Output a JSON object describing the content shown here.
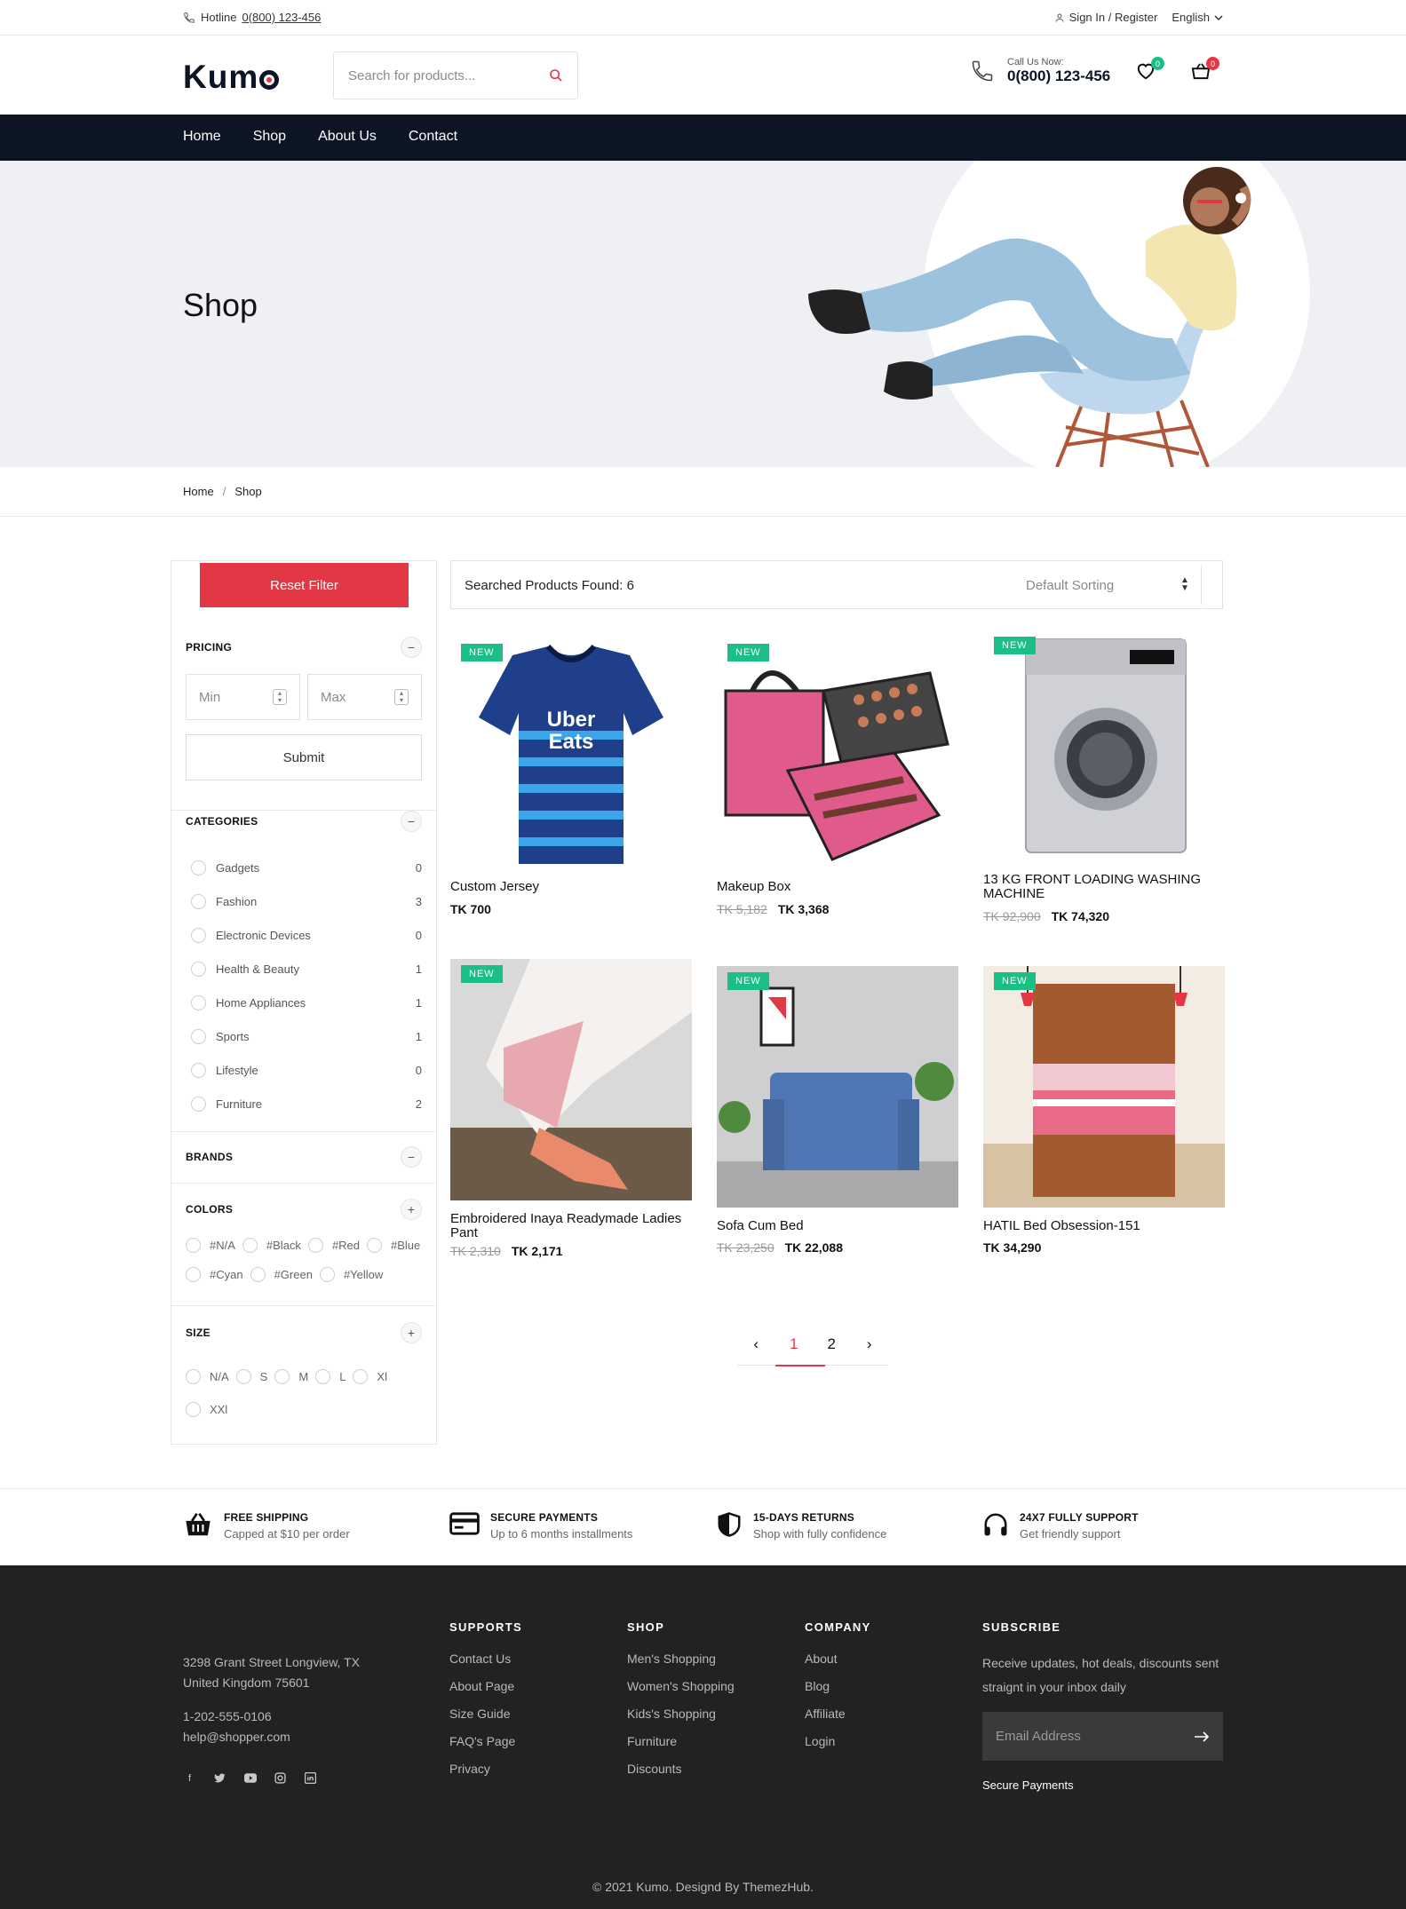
{
  "topbar": {
    "hotline_label": "Hotline",
    "hotline_number": "0(800) 123-456",
    "signin": "Sign In / Register",
    "language": "English"
  },
  "header": {
    "logo": "Kumo",
    "search_placeholder": "Search for products...",
    "call_label": "Call Us Now:",
    "call_number": "0(800) 123-456",
    "wishlist_count": "0",
    "cart_count": "0",
    "colors": {
      "accent": "#e23744",
      "navy": "#0b1524",
      "green": "#1bbf85"
    }
  },
  "nav": [
    "Home",
    "Shop",
    "About Us",
    "Contact"
  ],
  "hero": {
    "title": "Shop"
  },
  "breadcrumb": {
    "home": "Home",
    "sep": "/",
    "current": "Shop"
  },
  "sidebar": {
    "reset": "Reset Filter",
    "pricing": {
      "title": "PRICING",
      "min_placeholder": "Min",
      "max_placeholder": "Max",
      "submit": "Submit"
    },
    "categories": {
      "title": "CATEGORIES",
      "items": [
        {
          "label": "Gadgets",
          "count": "0"
        },
        {
          "label": "Fashion",
          "count": "3"
        },
        {
          "label": "Electronic Devices",
          "count": "0"
        },
        {
          "label": "Health & Beauty",
          "count": "1"
        },
        {
          "label": "Home Appliances",
          "count": "1"
        },
        {
          "label": "Sports",
          "count": "1"
        },
        {
          "label": "Lifestyle",
          "count": "0"
        },
        {
          "label": "Furniture",
          "count": "2"
        }
      ]
    },
    "brands": {
      "title": "BRANDS"
    },
    "colors": {
      "title": "COLORS",
      "row1": [
        "#N/A",
        "#Black",
        "#Red",
        "#Blue"
      ],
      "row2": [
        "#Cyan",
        "#Green",
        "#Yellow"
      ]
    },
    "size": {
      "title": "SIZE",
      "row1": [
        "N/A",
        "S",
        "M",
        "L",
        "Xl"
      ],
      "row2": [
        "XXl"
      ]
    }
  },
  "toolbar": {
    "found": "Searched Products Found: 6",
    "sort": "Default Sorting"
  },
  "products": [
    {
      "tag": "NEW",
      "name": "Custom Jersey",
      "old_price": "",
      "price": "TK 700"
    },
    {
      "tag": "NEW",
      "name": "Makeup Box",
      "old_price": "TK 5,182",
      "price": "TK 3,368"
    },
    {
      "tag": "NEW",
      "name": "13 KG FRONT LOADING WASHING MACHINE",
      "old_price": "TK 92,900",
      "price": "TK 74,320"
    },
    {
      "tag": "NEW",
      "name": "Embroidered Inaya Readymade Ladies Pant",
      "old_price": "TK 2,310",
      "price": "TK 2,171"
    },
    {
      "tag": "NEW",
      "name": "Sofa Cum Bed",
      "old_price": "TK 23,250",
      "price": "TK 22,088"
    },
    {
      "tag": "NEW",
      "name": "HATIL Bed Obsession-151",
      "old_price": "",
      "price": "TK 34,290"
    }
  ],
  "pagination": {
    "prev": "‹",
    "pages": [
      "1",
      "2"
    ],
    "next": "›",
    "current": "1"
  },
  "features": [
    {
      "icon": "basket-icon",
      "title": "FREE SHIPPING",
      "text": "Capped at $10 per order"
    },
    {
      "icon": "credit-card-icon",
      "title": "SECURE PAYMENTS",
      "text": "Up to 6 months installments"
    },
    {
      "icon": "shield-icon",
      "title": "15-DAYS RETURNS",
      "text": "Shop with fully confidence"
    },
    {
      "icon": "headphones-icon",
      "title": "24X7 FULLY SUPPORT",
      "text": "Get friendly support"
    }
  ],
  "footer": {
    "address1": "3298 Grant Street Longview, TX",
    "address2": "United Kingdom 75601",
    "phone": "1-202-555-0106",
    "email": "help@shopper.com",
    "supports": {
      "title": "SUPPORTS",
      "links": [
        "Contact Us",
        "About Page",
        "Size Guide",
        "FAQ's Page",
        "Privacy"
      ]
    },
    "shop": {
      "title": "SHOP",
      "links": [
        "Men's Shopping",
        "Women's Shopping",
        "Kids's Shopping",
        "Furniture",
        "Discounts"
      ]
    },
    "company": {
      "title": "COMPANY",
      "links": [
        "About",
        "Blog",
        "Affiliate",
        "Login"
      ]
    },
    "subscribe": {
      "title": "SUBSCRIBE",
      "text": "Receive updates, hot deals, discounts sent straignt in your inbox daily",
      "placeholder": "Email Address",
      "secure": "Secure Payments"
    },
    "copyright": "© 2021 Kumo. Designd By ThemezHub."
  }
}
